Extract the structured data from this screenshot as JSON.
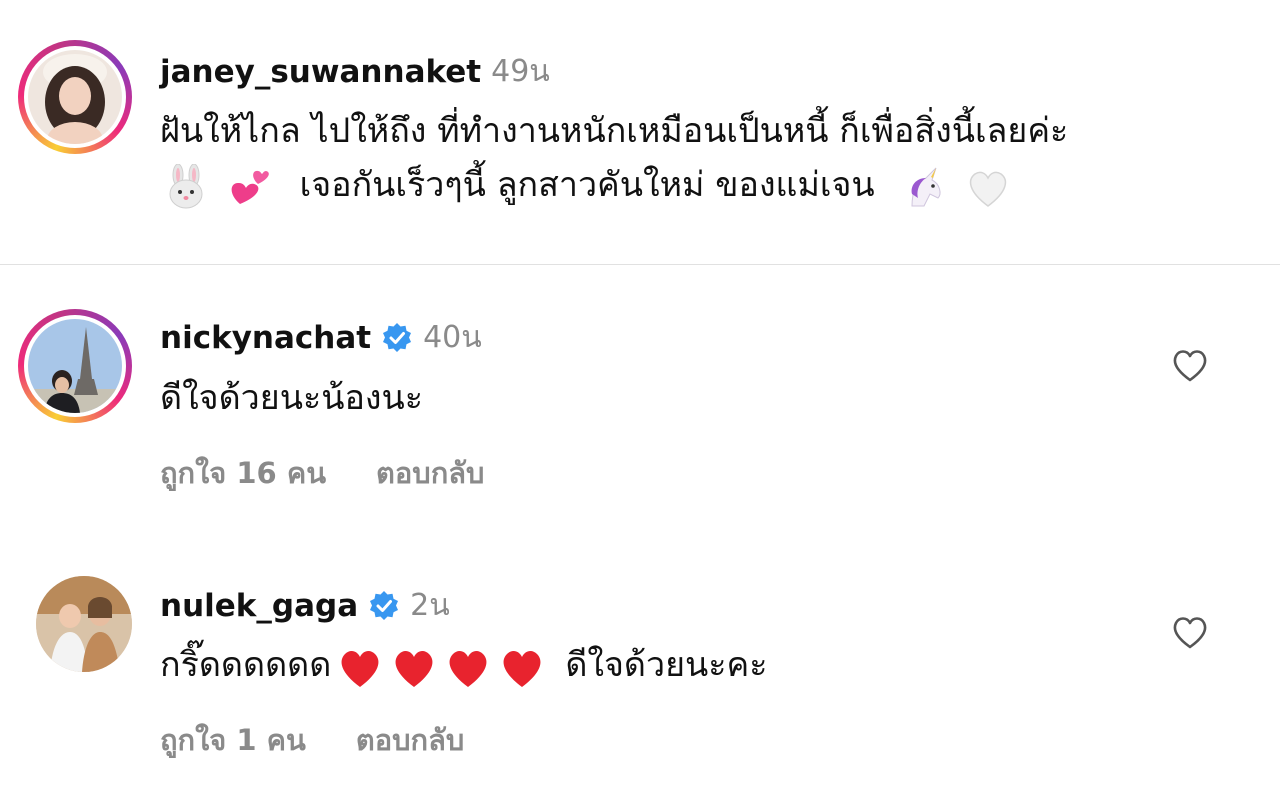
{
  "caption": {
    "username": "janey_suwannaket",
    "time": "49น",
    "line1": "ฝันให้ไกล ไปให้ถึง ที่ทำงานหนักเหมือนเป็นหนี้ ก็เพื่อสิ่งนี้เลยค่ะ",
    "line2_text": "เจอกันเร็วๆนี้ ลูกสาวคันใหม่ ของแม่เจน",
    "emojis_before": [
      "rabbit-face",
      "two-hearts"
    ],
    "emojis_after": [
      "unicorn",
      "white-heart"
    ]
  },
  "comments": [
    {
      "username": "nickynachat",
      "verified": true,
      "time": "40น",
      "text": "ดีใจด้วยนะน้องนะ",
      "likes": "ถูกใจ 16 คน",
      "reply": "ตอบกลับ"
    },
    {
      "username": "nulek_gaga",
      "verified": true,
      "time": "2น",
      "text_before": "กริ๊ดดดดดด",
      "text_after": "ดีใจด้วยนะคะ",
      "emojis": [
        "red-heart",
        "red-heart",
        "red-heart",
        "red-heart"
      ],
      "likes": "ถูกใจ 1 คน",
      "reply": "ตอบกลับ"
    }
  ],
  "colors": {
    "text": "#111111",
    "muted": "#8a8a8a",
    "verified": "#3897f0",
    "divider": "#e1e1e1"
  }
}
